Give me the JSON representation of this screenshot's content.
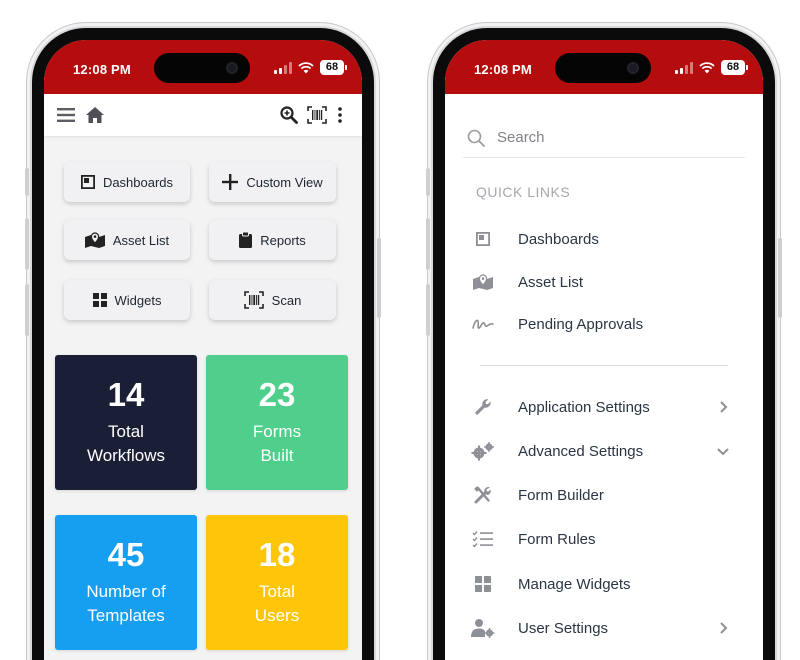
{
  "status_bar": {
    "time": "12:08 PM",
    "battery": "68"
  },
  "left_phone": {
    "quick_buttons": [
      {
        "label": "Dashboards",
        "icon": "dashboard-icon"
      },
      {
        "label": "Custom View",
        "icon": "plus-icon"
      },
      {
        "label": "Asset List",
        "icon": "map-marker-icon"
      },
      {
        "label": "Reports",
        "icon": "clipboard-icon"
      },
      {
        "label": "Widgets",
        "icon": "grid-icon"
      },
      {
        "label": "Scan",
        "icon": "barcode-scan-icon"
      }
    ],
    "stat_tiles": [
      {
        "value": "14",
        "line1": "Total",
        "line2": "Workflows",
        "color": "#1b1f36"
      },
      {
        "value": "23",
        "line1": "Forms",
        "line2": "Built",
        "color": "#4fcf8b"
      },
      {
        "value": "45",
        "line1": "Number of",
        "line2": "Templates",
        "color": "#169ff0"
      },
      {
        "value": "18",
        "line1": "Total",
        "line2": "Users",
        "color": "#ffc508"
      }
    ]
  },
  "right_phone": {
    "search_placeholder": "Search",
    "quick_links_title": "QUICK LINKS",
    "quick_links": [
      {
        "label": "Dashboards",
        "icon": "dashboard-icon"
      },
      {
        "label": "Asset List",
        "icon": "map-marker-icon"
      },
      {
        "label": "Pending Approvals",
        "icon": "signature-icon"
      }
    ],
    "settings": [
      {
        "label": "Application Settings",
        "icon": "wrench-icon",
        "chevron": "right"
      },
      {
        "label": "Advanced Settings",
        "icon": "gears-icon",
        "chevron": "down"
      },
      {
        "label": "Form Builder",
        "icon": "tools-icon",
        "chevron": ""
      },
      {
        "label": "Form Rules",
        "icon": "checklist-icon",
        "chevron": ""
      },
      {
        "label": "Manage Widgets",
        "icon": "grid-icon",
        "chevron": ""
      },
      {
        "label": "User Settings",
        "icon": "user-cog-icon",
        "chevron": "right"
      }
    ]
  },
  "colors": {
    "status_bar": "#b50d0d",
    "icon_gray": "#8d9096",
    "text_dark": "#2a3544"
  }
}
